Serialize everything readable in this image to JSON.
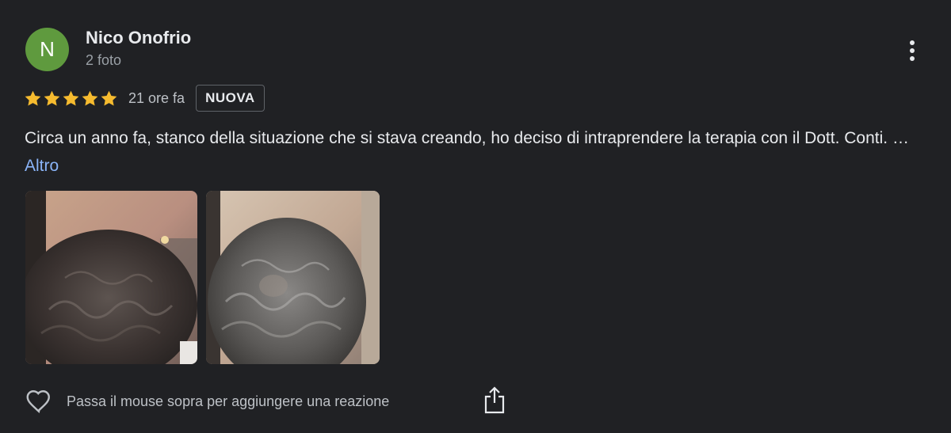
{
  "review": {
    "avatar_initial": "N",
    "author_name": "Nico Onofrio",
    "author_meta": "2 foto",
    "rating": 5,
    "rating_max": 5,
    "timestamp": "21 ore fa",
    "badge": "NUOVA",
    "text": "Circa un anno fa, stanco della situazione che si stava creando, ho deciso di intraprendere la terapia con il Dott. Conti. …",
    "more_link": "Altro",
    "photos": [
      {
        "description_icon": "photo-thumbnail"
      },
      {
        "description_icon": "photo-thumbnail"
      }
    ],
    "reaction_hint": "Passa il mouse sopra per aggiungere una reazione"
  },
  "colors": {
    "background": "#202124",
    "avatar": "#5f9a3e",
    "star": "#f6bb2f",
    "link": "#8ab4f8",
    "text_primary": "#e8eaed",
    "text_secondary": "#9aa0a6"
  },
  "icons": [
    "more-vert-icon",
    "star-icon",
    "heart-outline-icon",
    "share-icon"
  ]
}
